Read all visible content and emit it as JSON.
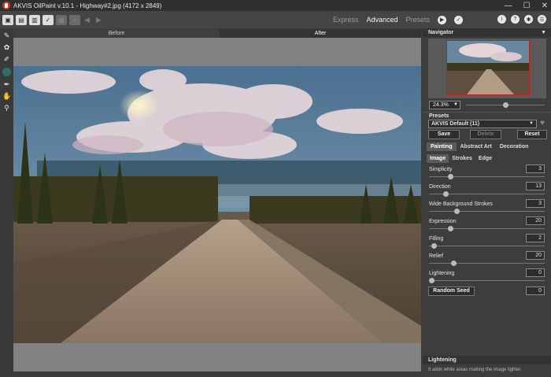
{
  "window": {
    "title": "AKVIS OilPaint v.10.1 - Highway#2.jpg (4172 x 2849)",
    "controls": [
      "—",
      "☐",
      "✕"
    ]
  },
  "toolbar": {
    "modes": [
      "Express",
      "Advanced",
      "Presets"
    ],
    "active_mode": "Advanced"
  },
  "view_tabs": {
    "before": "Before",
    "after": "After"
  },
  "navigator": {
    "title": "Navigator",
    "zoom": "24.3%",
    "zoom_fraction": 0.5
  },
  "presets": {
    "label": "Presets",
    "selected": "AKVIS Default (11)",
    "save": "Save",
    "delete": "Delete",
    "reset": "Reset"
  },
  "tabs": [
    "Painting",
    "Abstract Art",
    "Decoration"
  ],
  "subtabs": [
    "Image",
    "Strokes",
    "Edge"
  ],
  "params": [
    {
      "label": "Simplicity",
      "value": "3",
      "level": 0.17
    },
    {
      "label": "Direction",
      "value": "13",
      "level": 0.13
    },
    {
      "label": "Wide Background Strokes",
      "value": "3",
      "level": 0.23
    },
    {
      "label": "Expression",
      "value": "20",
      "level": 0.17
    },
    {
      "label": "Filling",
      "value": "2",
      "level": 0.02
    },
    {
      "label": "Relief",
      "value": "20",
      "level": 0.2
    },
    {
      "label": "Lightening",
      "value": "0",
      "level": 0.0
    }
  ],
  "random_seed": {
    "label": "Random Seed",
    "value": "0"
  },
  "hint": {
    "title": "Lightening",
    "text": "It adds white areas making the image lighter."
  }
}
